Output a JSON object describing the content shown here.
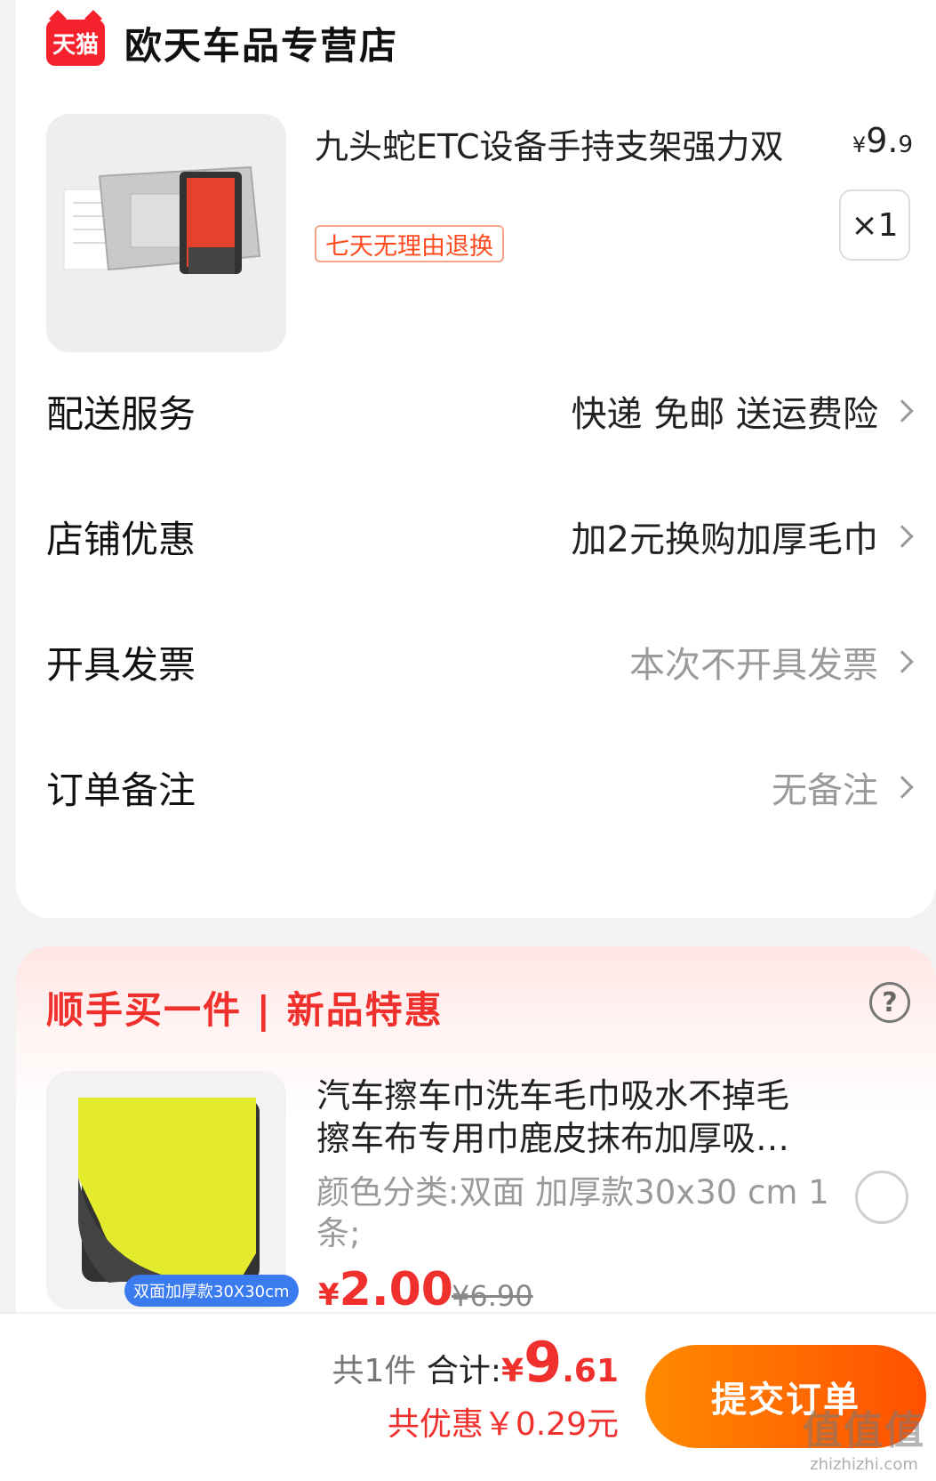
{
  "store": {
    "logo_text": "天猫",
    "name": "欧天车品专营店"
  },
  "product": {
    "title": "九头蛇ETC设备手持支架强力双",
    "price_currency": "¥",
    "price_int": "9.",
    "price_dec": "9",
    "quantity": "×1",
    "return_tag": "七天无理由退换"
  },
  "rows": [
    {
      "label": "配送服务",
      "value": "快递 免邮 送运费险"
    },
    {
      "label": "店铺优惠",
      "value": "加2元换购加厚毛巾"
    },
    {
      "label": "开具发票",
      "value": "本次不开具发票"
    },
    {
      "label": "订单备注",
      "value": "无备注"
    }
  ],
  "promo": {
    "title": "顺手买一件 | 新品特惠",
    "help": "?",
    "item_title": "汽车擦车巾洗车毛巾吸水不掉毛擦车布专用巾鹿皮抹布加厚吸…",
    "item_spec": "颜色分类:双面 加厚款30x30 cm 1条;",
    "item_badge": "双面加厚款30X30cm",
    "price_currency": "¥",
    "price": "2.00",
    "old_price": "¥6.90"
  },
  "summary": {
    "count": "共1件",
    "total_label": " 合计:",
    "total_currency": "¥",
    "total_int": "9",
    "total_dec": ".61",
    "discount": "共优惠￥0.29元"
  },
  "submit_label": "提交订单",
  "watermark": {
    "main": "值值值",
    "sub": "zhizhizhi.com"
  }
}
